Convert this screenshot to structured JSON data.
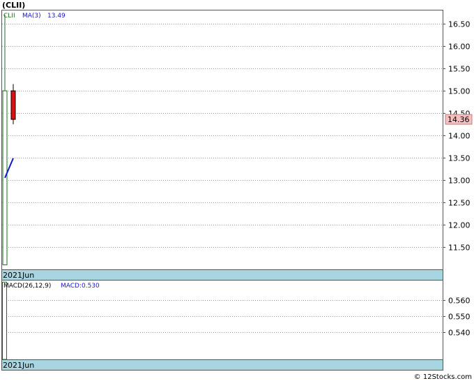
{
  "chart_data": [
    {
      "type": "candlestick",
      "title": "(CLII)",
      "symbol": "CLII",
      "ma_label": "MA(3)",
      "ma_value": "13.49",
      "x_label": "2021Jun",
      "last_price_label": "14.36",
      "ylim": [
        11.0,
        16.8
      ],
      "y_ticks": [
        "16.50",
        "16.00",
        "15.50",
        "15.00",
        "14.50",
        "14.00",
        "13.50",
        "13.00",
        "12.50",
        "12.00",
        "11.50"
      ],
      "grid": true,
      "candles": [
        {
          "open": 11.1,
          "high": 16.7,
          "low": 11.1,
          "close": 15.0,
          "color": "up"
        },
        {
          "open": 15.0,
          "high": 15.15,
          "low": 14.25,
          "close": 14.36,
          "color": "down"
        }
      ],
      "ma_series": [
        {
          "index": 0,
          "value": 13.05
        },
        {
          "index": 1,
          "value": 13.49
        }
      ]
    },
    {
      "type": "bar",
      "title": "MACD(26,12,9)",
      "macd_label": "MACD:0.530",
      "x_label": "2021Jun",
      "ylim": [
        0.523,
        0.572
      ],
      "y_ticks": [
        "0.560",
        "0.550",
        "0.540"
      ],
      "grid": true,
      "values": [
        0.571
      ]
    }
  ],
  "watermark": "© 12Stocks.com",
  "colors": {
    "up": "#1a6d1a",
    "down": "#e01010",
    "ma": "#1515cc",
    "axis_band": "#a7d5e0",
    "price_box": "#f4c0c0"
  }
}
